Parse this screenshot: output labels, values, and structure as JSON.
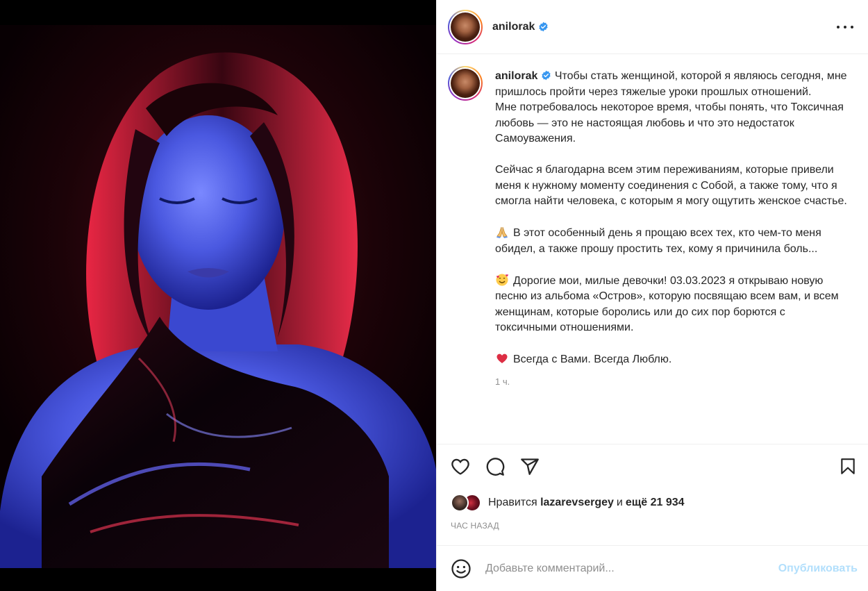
{
  "post": {
    "username": "anilorak",
    "verified": true,
    "caption": {
      "p1": "Чтобы стать женщиной, которой я являюсь сегодня, мне пришлось пройти через тяжелые уроки прошлых отношений.\nМне потребовалось некоторое время, чтобы понять, что Токсичная любовь — это не настоящая любовь и что это недостаток Самоуважения.",
      "p2": "Сейчас я благодарна всем этим переживаниям, которые привели меня к нужному моменту соединения с Собой, а также тому, что я смогла найти человека, с которым я могу ощутить женское счастье.",
      "p3": "В этот особенный день я прощаю всех тех, кто чем-то меня обидел, а также прошу простить тех, кому я причинила боль...",
      "p4": "Дорогие мои, милые девочки! 03.03.2023 я открываю новую песню из альбома «Остров», которую посвящаю всем вам, и всем женщинам, которые боролись или до сих пор борются с токсичными отношениями.",
      "p5": "Всегда с Вами. Всегда Люблю."
    },
    "time_ago": "1 ч.",
    "likes": {
      "prefix": "Нравится",
      "user": "lazarevsergey",
      "middle": "и",
      "count": "ещё 21 934"
    },
    "posted_label": "ЧАС НАЗАД"
  },
  "comment": {
    "placeholder": "Добавьте комментарий...",
    "publish_label": "Опубликовать"
  },
  "icons": {
    "more": "more-horizontal-icon",
    "like": "heart-icon",
    "comment": "comment-bubble-icon",
    "share": "paper-plane-icon",
    "save": "bookmark-icon",
    "emoji": "smile-emoji-icon",
    "verified": "verified-badge-icon"
  },
  "colors": {
    "verified": "#3897f0",
    "publish_disabled": "#b2dffc",
    "secondary_text": "#8e8e8e",
    "divider": "#efefef"
  }
}
